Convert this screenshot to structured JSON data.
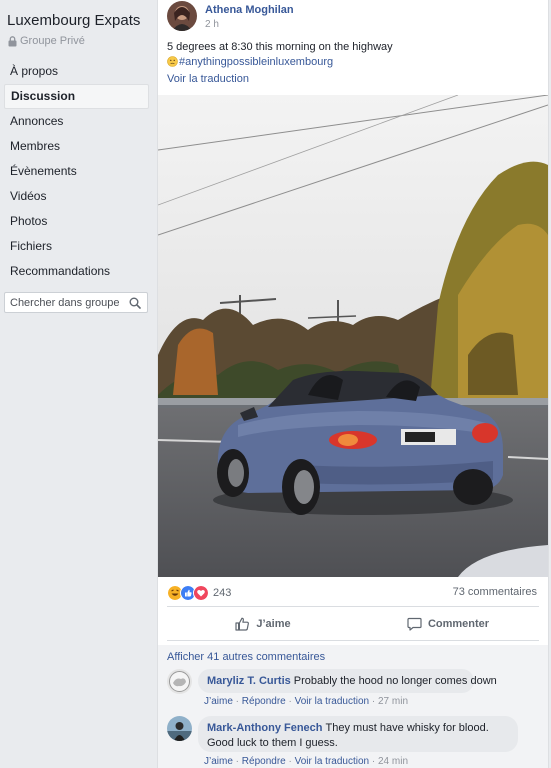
{
  "group": {
    "title": "Luxembourg Expats",
    "privacy": "Groupe Privé"
  },
  "sidebar": {
    "items": [
      {
        "label": "À propos"
      },
      {
        "label": "Discussion"
      },
      {
        "label": "Annonces"
      },
      {
        "label": "Membres"
      },
      {
        "label": "Évènements"
      },
      {
        "label": "Vidéos"
      },
      {
        "label": "Photos"
      },
      {
        "label": "Fichiers"
      },
      {
        "label": "Recommandations"
      }
    ],
    "active": "Discussion",
    "search": {
      "placeholder": "Chercher dans groupe"
    }
  },
  "post": {
    "author": "Athena Moghilan",
    "time": "2 h",
    "text": "5 degrees at 8:30 this morning on the highway",
    "hashtag": "#anythingpossibleinluxembourg",
    "see_translation": "Voir la traduction",
    "reaction_count": "243",
    "comments_count": "73 commentaires",
    "like_label": "J’aime",
    "comment_label": "Commenter"
  },
  "comments": {
    "view_more": "Afficher 41 autres commentaires",
    "items": [
      {
        "name": "Maryliz T. Curtis",
        "text": "Probably the hood no longer comes down",
        "like": "J’aime",
        "reply": "Répondre",
        "translate": "Voir la traduction",
        "time": "27 min"
      },
      {
        "name": "Mark-Anthony Fenech",
        "text": "They must have whisky for blood. Good luck to them I guess.",
        "like": "J’aime",
        "reply": "Répondre",
        "translate": "Voir la traduction",
        "time": "24 min"
      }
    ]
  },
  "colors": {
    "link": "#385898",
    "background": "#e9ebee",
    "muted": "#90949c"
  },
  "icons": [
    "lock-icon",
    "search-icon",
    "haha-reaction-icon",
    "like-reaction-icon",
    "love-reaction-icon",
    "thumbs-up-icon",
    "comment-icon",
    "thinking-face-emoji"
  ]
}
